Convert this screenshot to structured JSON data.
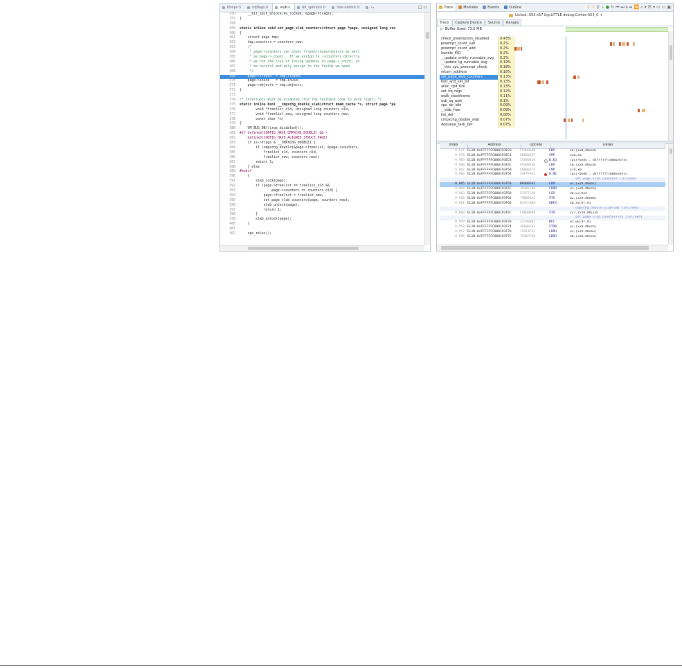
{
  "editor": {
    "tabs": [
      {
        "label": "bitops.S",
        "active": false
      },
      {
        "label": "irqflags.h",
        "active": false
      },
      {
        "label": "slub.c",
        "active": true
      },
      {
        "label": "bit_spinlock.h",
        "active": false
      },
      {
        "label": "non-atomic.h",
        "active": false
      },
      {
        "label": "»₃",
        "active": false
      }
    ],
    "window_controls": "□ ▭",
    "lines": [
      {
        "n": "356",
        "t": "    __bit_spin_unlock(PG_locked, &page->flags);",
        "k": ""
      },
      {
        "n": "357",
        "t": "}",
        "k": ""
      },
      {
        "n": "358",
        "t": "",
        "k": ""
      },
      {
        "n": "359",
        "t": "static inline void set_page_slub_counters(struct page *page, unsigned long cou",
        "k": "kw"
      },
      {
        "n": "360",
        "t": "{",
        "k": ""
      },
      {
        "n": "361",
        "t": "    struct page tmp;",
        "k": ""
      },
      {
        "n": "362",
        "t": "    tmp.counters = counters_new;",
        "k": ""
      },
      {
        "n": "363",
        "t": "    /*",
        "k": "cm"
      },
      {
        "n": "364",
        "t": "     * page->counters can cover frozen/inuse/objects as well",
        "k": "cm"
      },
      {
        "n": "365",
        "t": "     * as page->_count.  If we assign to ->counters directly",
        "k": "cm"
      },
      {
        "n": "366",
        "t": "     * we run the risk of losing updates to page->_count, so",
        "k": "cm"
      },
      {
        "n": "367",
        "t": "     * be careful and only assign to the fields we need.",
        "k": "cm"
      },
      {
        "n": "368",
        "t": "     */",
        "k": "cm"
      },
      {
        "n": "369",
        "t": "    page->frozen  = tmp.frozen;",
        "k": "hl"
      },
      {
        "n": "370",
        "t": "    page->inuse   = tmp.inuse;",
        "k": ""
      },
      {
        "n": "371",
        "t": "    page->objects = tmp.objects;",
        "k": ""
      },
      {
        "n": "372",
        "t": "}",
        "k": ""
      },
      {
        "n": "373",
        "t": "",
        "k": ""
      },
      {
        "n": "374",
        "t": "/* Interrupts must be disabled (for the fallback code to work right) */",
        "k": "cm"
      },
      {
        "n": "375",
        "t": "static inline bool __cmpxchg_double_slab(struct kmem_cache *s, struct page *pa",
        "k": "kw"
      },
      {
        "n": "376",
        "t": "        void *freelist_old, unsigned long counters_old,",
        "k": ""
      },
      {
        "n": "377",
        "t": "        void *freelist_new, unsigned long counters_new,",
        "k": ""
      },
      {
        "n": "378",
        "t": "        const char *n)",
        "k": ""
      },
      {
        "n": "379",
        "t": "{",
        "k": ""
      },
      {
        "n": "380",
        "t": "    VM_BUG_ON(!irqs_disabled());",
        "k": ""
      },
      {
        "n": "381",
        "t": "#if defined(CONFIG_HAVE_CMPXCHG_DOUBLE) && \\",
        "k": "pp"
      },
      {
        "n": "382",
        "t": "    defined(CONFIG_HAVE_ALIGNED_STRUCT_PAGE)",
        "k": "pp"
      },
      {
        "n": "383",
        "t": "    if (s->flags & __CMPXCHG_DOUBLE) {",
        "k": ""
      },
      {
        "n": "384",
        "t": "        if (cmpxchg_double(&page->freelist, &page->counters,",
        "k": ""
      },
      {
        "n": "385",
        "t": "            freelist_old, counters_old,",
        "k": ""
      },
      {
        "n": "386",
        "t": "            freelist_new, counters_new))",
        "k": ""
      },
      {
        "n": "387",
        "t": "        return 1;",
        "k": ""
      },
      {
        "n": "388",
        "t": "    } else",
        "k": ""
      },
      {
        "n": "389",
        "t": "#endif",
        "k": "pp"
      },
      {
        "n": "390",
        "t": "    {",
        "k": ""
      },
      {
        "n": "391",
        "t": "        slab_lock(page);",
        "k": ""
      },
      {
        "n": "392",
        "t": "        if (page->freelist == freelist_old &&",
        "k": ""
      },
      {
        "n": "393",
        "t": "                page->counters == counters_old) {",
        "k": ""
      },
      {
        "n": "394",
        "t": "            page->freelist = freelist_new;",
        "k": ""
      },
      {
        "n": "395",
        "t": "            set_page_slub_counters(page, counters_new);",
        "k": ""
      },
      {
        "n": "396",
        "t": "            slab_unlock(page);",
        "k": ""
      },
      {
        "n": "397",
        "t": "            return 1;",
        "k": ""
      },
      {
        "n": "398",
        "t": "        }",
        "k": ""
      },
      {
        "n": "399",
        "t": "        slab_unlock(page);",
        "k": ""
      },
      {
        "n": "400",
        "t": "    }",
        "k": ""
      },
      {
        "n": "401",
        "t": "",
        "k": ""
      },
      {
        "n": "402",
        "t": "    cpu_relax();",
        "k": ""
      }
    ]
  },
  "trace": {
    "view_tabs": [
      {
        "label": "Trace",
        "active": true,
        "icon_color": "#e4b24a"
      },
      {
        "label": "Modules",
        "active": false,
        "icon_color": "#d08a3a"
      },
      {
        "label": "Events",
        "active": false,
        "icon_color": "#6f8fbf"
      },
      {
        "label": "Outline",
        "active": false,
        "icon_color": "#4f80c0"
      }
    ],
    "toolbar_icons": [
      "⇩",
      "⇧",
      "⚲",
      "⇣",
      "●",
      "↻",
      "⏮",
      "⏭",
      "⏵",
      "⏯",
      "⏩",
      "⌕",
      "▾",
      "☰",
      "▾",
      "▭",
      "▭",
      "▣"
    ],
    "link_text": "Linked: A53-x57 big.LITTLE debug:Cortex-A53_0",
    "link_dropdown": "▾",
    "sub_tabs": [
      {
        "label": "Trace",
        "active": true
      },
      {
        "label": "Capture Device",
        "active": false
      },
      {
        "label": "Source",
        "active": false
      },
      {
        "label": "Ranges",
        "active": false
      }
    ],
    "buffer_label": "Buffer Used: 73.5 MB",
    "profile_rows": [
      {
        "name": "check_preemption_disabled",
        "pct": "0.43%",
        "segs": []
      },
      {
        "name": "preempt_count_sub",
        "pct": "0.2%",
        "segs": [
          [
            124,
            3
          ],
          [
            128,
            3
          ],
          [
            136,
            3
          ],
          [
            140,
            4
          ],
          [
            146,
            3
          ],
          [
            154,
            3
          ]
        ]
      },
      {
        "name": "preempt_count_add",
        "pct": "0.2%",
        "segs": [
          [
            0,
            3
          ],
          [
            3,
            4
          ],
          [
            8,
            2
          ]
        ]
      },
      {
        "name": "handle_IRQ",
        "pct": "0.2%",
        "segs": []
      },
      {
        "name": "__update_entity_runnable_avg",
        "pct": "0.2%",
        "segs": []
      },
      {
        "name": "__update_tg_runnable_avg",
        "pct": "0.19%",
        "segs": []
      },
      {
        "name": "__this_cpu_preempt_check",
        "pct": "0.18%",
        "segs": []
      },
      {
        "name": "return_address",
        "pct": "0.18%",
        "segs": []
      },
      {
        "name": "set_page_slub_counters",
        "pct": "0.13%",
        "segs": [
          [
            77,
            3
          ],
          [
            82,
            3
          ]
        ],
        "sel": true
      },
      {
        "name": "test_and_set_bit",
        "pct": "0.13%",
        "segs": [
          [
            30,
            4
          ],
          [
            36,
            3
          ],
          [
            41,
            3
          ]
        ]
      },
      {
        "name": "alloc_cpd_tick",
        "pct": "0.13%",
        "segs": []
      },
      {
        "name": "set_irq_regs",
        "pct": "0.12%",
        "segs": []
      },
      {
        "name": "walk_stackframe",
        "pct": "0.11%",
        "segs": []
      },
      {
        "name": "usb_sq_wait",
        "pct": "0.1%",
        "segs": []
      },
      {
        "name": "cpu_do_idle",
        "pct": "0.09%",
        "segs": []
      },
      {
        "name": "__slab_free",
        "pct": "0.09%",
        "segs": [
          [
            160,
            3
          ],
          [
            166,
            4
          ]
        ]
      },
      {
        "name": "list_del",
        "pct": "0.08%",
        "segs": []
      },
      {
        "name": "cmpxchg_double_slab",
        "pct": "0.07%",
        "segs": [
          [
            64,
            3
          ],
          [
            69,
            3
          ],
          [
            74,
            2
          ],
          [
            88,
            2
          ]
        ]
      },
      {
        "name": "dequeue_task_fair",
        "pct": "0.07%",
        "segs": []
      }
    ],
    "disasm_headers": {
      "index": "Index",
      "address": "Address",
      "opcode": "Opcode",
      "detail": "Detail"
    },
    "disasm_rows": [
      {
        "idx": "-9,971",
        "addr": "EL1N:0xFFFFFFC000193EC0",
        "op": "F9400a80",
        "bp": "",
        "mn": "LDR",
        "det": "x0,[x20,#0x10]",
        "cls": ""
      },
      {
        "idx": "-9,970",
        "addr": "EL1N:0xFFFFFFC000193EC4",
        "op": "EB00029F",
        "bp": "",
        "mn": "CMP",
        "det": "x20,x0",
        "cls": ""
      },
      {
        "idx": "-9,969",
        "addr": "EL1N:0xFFFFFFC000193EC8",
        "op": "54000420",
        "bp": "ring",
        "mn": "B.EQ",
        "det": "{pc}+0x84  ; 0xffffffc000193f4c",
        "cls": ""
      },
      {
        "idx": "-9,968",
        "addr": "EL1N:0xFFFFFFC000193F4C",
        "op": "F9400E80",
        "bp": "",
        "mn": "LDR",
        "det": "x0,[x20,#0x18]",
        "cls": ""
      },
      {
        "idx": "-9,967",
        "addr": "EL1N:0xFFFFFFC000193F50",
        "op": "EB00027F",
        "bp": "",
        "mn": "CMP",
        "det": "x19,x0",
        "cls": ""
      },
      {
        "idx": "-9,966",
        "addr": "EL1N:0xFFFFFFC000193F54",
        "op": "54FFF9A1",
        "bp": "dot",
        "mn": "B.NE",
        "det": "{pc}-0x88  ; 0xffffffc000193ecc",
        "cls": ""
      },
      {
        "idx": "",
        "addr": "",
        "op": "",
        "bp": "",
        "mn": "",
        "det": "set_page_slub_counters [inlined]",
        "cls": "fn"
      },
      {
        "idx": "-9,965",
        "addr": "EL1N:0xFFFFFFC000193F58",
        "op": "B9406FA2",
        "bp": "",
        "mn": "LDR",
        "det": "w2,[x29,#0x6c]",
        "cls": "sel"
      },
      {
        "idx": "-9,964",
        "addr": "EL1N:0xFFFFFFC000193F5C",
        "op": "39405F80",
        "bp": "",
        "mn": "LDRB",
        "det": "w1,[x28,#0x1b]",
        "cls": ""
      },
      {
        "idx": "-9,963",
        "addr": "EL1N:0xFFFFFFC000193F60",
        "op": "531F7C40",
        "bp": "",
        "mn": "LSR",
        "det": "w0,w2,#24",
        "cls": ""
      },
      {
        "idx": "-9,962",
        "addr": "EL1N:0xFFFFFFC000193F64",
        "op": "790003A2",
        "bp": "",
        "mn": "STR",
        "det": "w2,[x29,#0x60]",
        "cls": ""
      },
      {
        "idx": "-9,961",
        "addr": "EL1N:0xFFFFFFC000193F68",
        "op": "D347C000",
        "bp": "",
        "mn": "UBFX",
        "det": "x0,x0,#7,#1",
        "cls": ""
      },
      {
        "idx": "",
        "addr": "",
        "op": "",
        "bp": "",
        "mn": "",
        "det": "cmpxchg_double_slab+284 [inlined]",
        "cls": "fn"
      },
      {
        "idx": "-9,960",
        "addr": "EL1N:0xFFFFFFC000193F6C",
        "op": "F9000B90",
        "bp": "",
        "mn": "STR",
        "det": "x27,[x28,#8]{0}",
        "cls": ""
      },
      {
        "idx": "",
        "addr": "",
        "op": "",
        "bp": "",
        "mn": "",
        "det": "set_page_slub_counters+24 [inlined]",
        "cls": "fn"
      },
      {
        "idx": "-9,959",
        "addr": "EL1N:0xFFFFFFC000193F70",
        "op": "33190001",
        "bp": "",
        "mn": "BFI",
        "det": "w1,w0,#7,#1",
        "cls": ""
      },
      {
        "idx": "-9,958",
        "addr": "EL1N:0xFFFFFFC000193F74",
        "op": "39006F81",
        "bp": "",
        "mn": "STRB",
        "det": "w1,[x28,#0x1b]",
        "cls": ""
      },
      {
        "idx": "-9,957",
        "addr": "EL1N:0xFFFFFFC000193F78",
        "op": "79414FA1",
        "bp": "",
        "mn": "LDRH",
        "det": "w1,[x29,#0x62]",
        "cls": ""
      },
      {
        "idx": "-9,956",
        "addr": "EL1N:0xFFFFFFC000193F7C",
        "op": "79403780",
        "bp": "",
        "mn": "LDRH",
        "det": "w0,[x28,#0x1a]",
        "cls": ""
      }
    ]
  }
}
